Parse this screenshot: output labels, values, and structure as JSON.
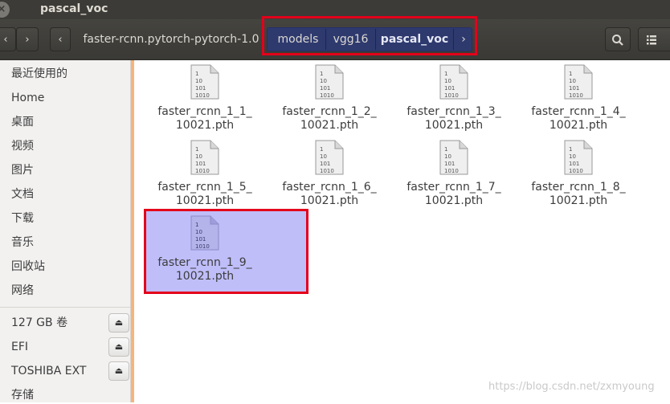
{
  "window": {
    "title": "pascal_voc"
  },
  "toolbar": {
    "back": "‹",
    "forward": "›",
    "path_left_arrow": "‹",
    "parent_crumb": "faster-rcnn.pytorch-pytorch-1.0",
    "crumbs": [
      "models",
      "vgg16",
      "pascal_voc"
    ],
    "path_right_arrow": "›",
    "search_icon": "search-icon",
    "list_icon": "list-view-icon"
  },
  "sidebar": {
    "items": [
      {
        "label": "最近使用的",
        "icon": "clock-icon"
      },
      {
        "label": "Home",
        "icon": "home-icon"
      },
      {
        "label": "桌面",
        "icon": "desktop-icon"
      },
      {
        "label": "视频",
        "icon": "video-icon"
      },
      {
        "label": "图片",
        "icon": "picture-icon"
      },
      {
        "label": "文档",
        "icon": "document-icon"
      },
      {
        "label": "下载",
        "icon": "download-icon"
      },
      {
        "label": "音乐",
        "icon": "music-icon"
      },
      {
        "label": "回收站",
        "icon": "trash-icon"
      },
      {
        "label": "网络",
        "icon": "network-icon"
      }
    ],
    "devices": [
      {
        "label": "127 GB 卷",
        "eject": "⏏"
      },
      {
        "label": "EFI",
        "eject": "⏏"
      },
      {
        "label": "TOSHIBA EXT",
        "eject": "⏏"
      }
    ],
    "footer_item": "存储"
  },
  "files": [
    {
      "line1": "faster_rcnn_1_1_",
      "line2": "10021.pth",
      "selected": false
    },
    {
      "line1": "faster_rcnn_1_2_",
      "line2": "10021.pth",
      "selected": false
    },
    {
      "line1": "faster_rcnn_1_3_",
      "line2": "10021.pth",
      "selected": false
    },
    {
      "line1": "faster_rcnn_1_4_",
      "line2": "10021.pth",
      "selected": false
    },
    {
      "line1": "faster_rcnn_1_5_",
      "line2": "10021.pth",
      "selected": false
    },
    {
      "line1": "faster_rcnn_1_6_",
      "line2": "10021.pth",
      "selected": false
    },
    {
      "line1": "faster_rcnn_1_7_",
      "line2": "10021.pth",
      "selected": false
    },
    {
      "line1": "faster_rcnn_1_8_",
      "line2": "10021.pth",
      "selected": false
    },
    {
      "line1": "faster_rcnn_1_9_",
      "line2": "10021.pth",
      "selected": true
    }
  ],
  "file_icon_text": [
    "1",
    "10",
    "101",
    "1010"
  ],
  "watermark": "https://blog.csdn.net/zxmyoung",
  "colors": {
    "highlight": "#e3001b",
    "selection": "#bfbef9",
    "crumb_active": "#2e3a6e"
  }
}
